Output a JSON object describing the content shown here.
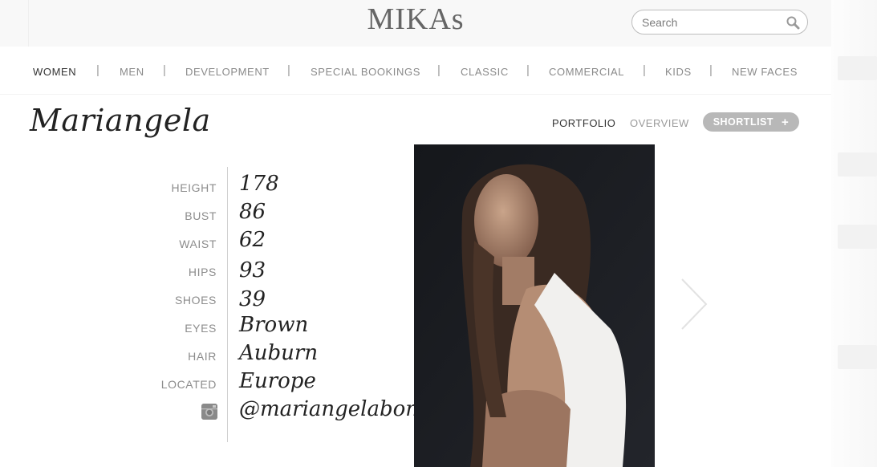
{
  "header": {
    "logo": "MIKAs",
    "search_placeholder": "Search"
  },
  "nav": [
    {
      "label": "WOMEN",
      "active": true
    },
    {
      "label": "MEN"
    },
    {
      "label": "DEVELOPMENT"
    },
    {
      "label": "SPECIAL BOOKINGS"
    },
    {
      "label": "CLASSIC"
    },
    {
      "label": "COMMERCIAL"
    },
    {
      "label": "KIDS"
    },
    {
      "label": "NEW FACES"
    }
  ],
  "nav_separator": "|",
  "model": {
    "name": "Mariangela",
    "tabs": {
      "portfolio": "PORTFOLIO",
      "overview": "OVERVIEW"
    },
    "shortlist_label": "SHORTLIST",
    "shortlist_icon": "+"
  },
  "stats": [
    {
      "label": "HEIGHT",
      "value": "178"
    },
    {
      "label": "BUST",
      "value": "86"
    },
    {
      "label": "WAIST",
      "value": "62"
    },
    {
      "label": "HIPS",
      "value": "93"
    },
    {
      "label": "SHOES",
      "value": "39"
    },
    {
      "label": "EYES",
      "value": "Brown"
    },
    {
      "label": "HAIR",
      "value": "Auburn"
    },
    {
      "label": "LOCATED",
      "value": "Europe"
    }
  ],
  "instagram": {
    "icon": "instagram-icon",
    "handle": "@mariangelabonanni"
  },
  "colors": {
    "shortlist_bg": "#b8b8b8",
    "photo_bg": "#1b1d22"
  }
}
